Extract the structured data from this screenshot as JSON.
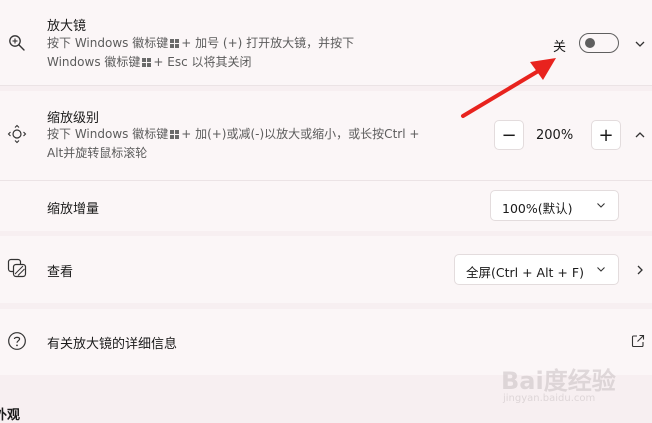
{
  "magnifier": {
    "title": "放大镜",
    "desc_line1_a": "按下 Windows 徽标键",
    "desc_line1_b": "+ 加号 (+) 打开放大镜，并按下",
    "desc_line2_a": "Windows 徽标键",
    "desc_line2_b": "+ Esc 以将其关闭",
    "toggle_label": "关",
    "toggle_on": false,
    "icon": "magnifier-icon"
  },
  "zoom_level": {
    "title": "缩放级别",
    "desc_line1_a": "按下 Windows 徽标键",
    "desc_line1_b": "+ 加(+)或减(-)以放大或缩小，或长按Ctrl +",
    "desc_line2": "Alt并旋转鼠标滚轮",
    "minus_label": "−",
    "plus_label": "+",
    "value": "200%",
    "icon": "zoom-move-icon"
  },
  "zoom_increment": {
    "title": "缩放增量",
    "selected": "100%(默认)"
  },
  "view": {
    "title": "查看",
    "selected": "全屏(Ctrl + Alt + F)",
    "icon": "view-icon"
  },
  "help": {
    "title": "有关放大镜的详细信息",
    "icon": "help-icon",
    "external_icon": "open-external-icon"
  },
  "next_section_heading": "外观",
  "watermark": {
    "main": "Bai度经验",
    "sub": "jingyan.baidu.com"
  },
  "colors": {
    "annotation_arrow": "#e8231e",
    "card_bg": "#fbf6f7",
    "page_bg": "#f7eff1"
  }
}
